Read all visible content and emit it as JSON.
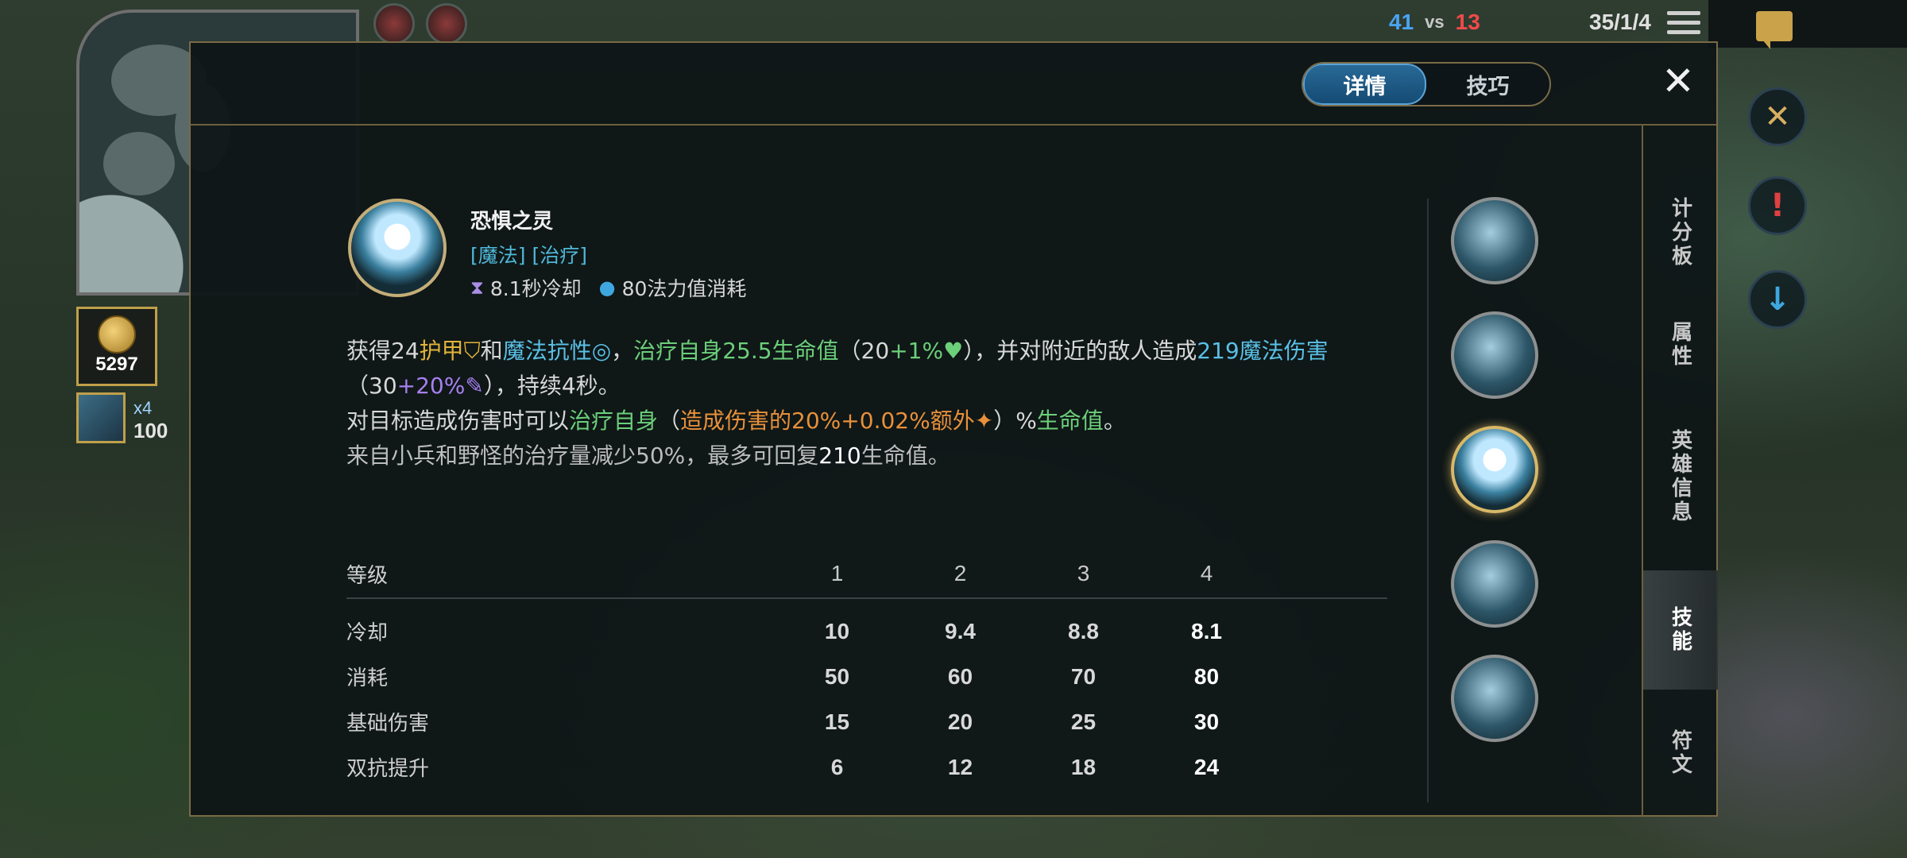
{
  "scoreboard": {
    "team_blue_kills": "41",
    "vs_label": "vs",
    "team_red_kills": "13",
    "kda": "35/1/4"
  },
  "hud": {
    "gold": "5297",
    "item_stack": "x4",
    "item_value": "100"
  },
  "dialog": {
    "tabs": [
      {
        "label": "详情",
        "active": true
      },
      {
        "label": "技巧",
        "active": false
      }
    ],
    "close_icon": "✕",
    "ability": {
      "name": "恐惧之灵",
      "tags": "[魔法] [治疗]",
      "cooldown": "8.1秒冷却",
      "cost": "80法力值消耗"
    },
    "description": {
      "l1_a": "获得24",
      "l1_armor": "护甲",
      "l1_and": "和",
      "l1_mr": "魔法抗性",
      "l1_comma": "，",
      "l1_heal": "治疗",
      "l1_self": "自身",
      "l1_hp": "25.5生命值",
      "l1_paren_open": "（20",
      "l1_ratio": "+1%",
      "l1_paren_close": "），并对附近的敌人造成",
      "l1_dmg": "219魔法伤害",
      "l2_paren_open": "（30",
      "l2_ap": "+20%",
      "l2_rest": "），持续4秒。",
      "l3_a": "对目标造成伤害时可以",
      "l3_heal": "治疗自身",
      "l3_paren": "（",
      "l3_dmg": "造成伤害的20%",
      "l3_bonus": "+0.02%额外",
      "l3_close": "）%",
      "l3_hp": "生命值",
      "l3_end": "。",
      "l4_a": "来自小兵和野怪的治疗量减少50%，最多可回复",
      "l4_amt": "210",
      "l4_b": "生命值。"
    },
    "table": {
      "header_label": "等级",
      "levels": [
        "1",
        "2",
        "3",
        "4"
      ],
      "rows": [
        {
          "label": "冷却",
          "values": [
            "10",
            "9.4",
            "8.8",
            "8.1"
          ]
        },
        {
          "label": "消耗",
          "values": [
            "50",
            "60",
            "70",
            "80"
          ]
        },
        {
          "label": "基础伤害",
          "values": [
            "15",
            "20",
            "25",
            "30"
          ]
        },
        {
          "label": "双抗提升",
          "values": [
            "6",
            "12",
            "18",
            "24"
          ]
        }
      ]
    },
    "side_tabs": [
      {
        "label": "计分板",
        "active": false
      },
      {
        "label": "属性",
        "active": false
      },
      {
        "label": "英雄信息",
        "active": false
      },
      {
        "label": "技能",
        "active": true
      },
      {
        "label": "符文",
        "active": false
      }
    ]
  }
}
